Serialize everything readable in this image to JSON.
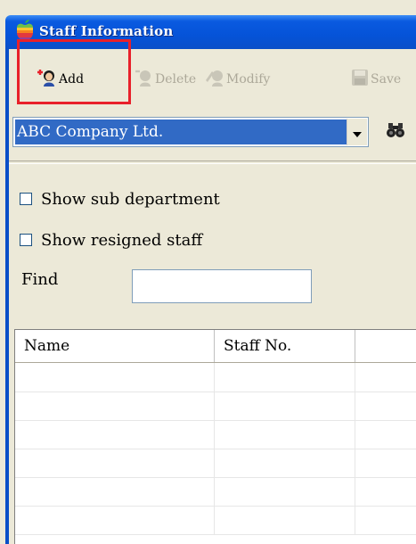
{
  "window": {
    "title": "Staff Information"
  },
  "toolbar": {
    "add_label": "Add",
    "delete_label": "Delete",
    "modify_label": "Modify",
    "save_label": "Save"
  },
  "company_select": {
    "value": "ABC Company Ltd."
  },
  "filters": {
    "show_sub_department": {
      "label": "Show sub department",
      "checked": false
    },
    "show_resigned_staff": {
      "label": "Show resigned staff",
      "checked": false
    },
    "find_label": "Find",
    "find_value": ""
  },
  "grid": {
    "columns": [
      "Name",
      "Staff No.",
      ""
    ],
    "rows": [
      [
        "",
        "",
        ""
      ],
      [
        "",
        "",
        ""
      ],
      [
        "",
        "",
        ""
      ],
      [
        "",
        "",
        ""
      ],
      [
        "",
        "",
        ""
      ],
      [
        "",
        "",
        ""
      ]
    ]
  },
  "colors": {
    "titlebar": "#0553d8",
    "selection": "#316ac5",
    "highlight_box": "#e8202a",
    "window_bg": "#ece9d8"
  },
  "icons": {
    "app": "apple-icon",
    "add": "add-user-icon",
    "delete": "delete-user-icon",
    "modify": "modify-user-icon",
    "save": "save-icon",
    "find": "binoculars-icon"
  }
}
